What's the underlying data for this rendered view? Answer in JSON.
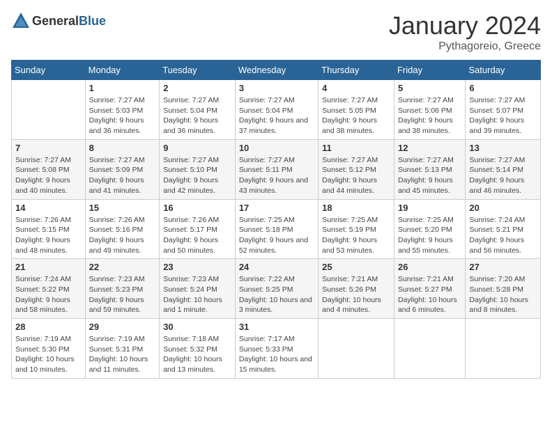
{
  "header": {
    "logo_general": "General",
    "logo_blue": "Blue",
    "title": "January 2024",
    "location": "Pythagoreio, Greece"
  },
  "days_of_week": [
    "Sunday",
    "Monday",
    "Tuesday",
    "Wednesday",
    "Thursday",
    "Friday",
    "Saturday"
  ],
  "weeks": [
    [
      {
        "day": "",
        "sunrise": "",
        "sunset": "",
        "daylight": ""
      },
      {
        "day": "1",
        "sunrise": "Sunrise: 7:27 AM",
        "sunset": "Sunset: 5:03 PM",
        "daylight": "Daylight: 9 hours and 36 minutes."
      },
      {
        "day": "2",
        "sunrise": "Sunrise: 7:27 AM",
        "sunset": "Sunset: 5:04 PM",
        "daylight": "Daylight: 9 hours and 36 minutes."
      },
      {
        "day": "3",
        "sunrise": "Sunrise: 7:27 AM",
        "sunset": "Sunset: 5:04 PM",
        "daylight": "Daylight: 9 hours and 37 minutes."
      },
      {
        "day": "4",
        "sunrise": "Sunrise: 7:27 AM",
        "sunset": "Sunset: 5:05 PM",
        "daylight": "Daylight: 9 hours and 38 minutes."
      },
      {
        "day": "5",
        "sunrise": "Sunrise: 7:27 AM",
        "sunset": "Sunset: 5:06 PM",
        "daylight": "Daylight: 9 hours and 38 minutes."
      },
      {
        "day": "6",
        "sunrise": "Sunrise: 7:27 AM",
        "sunset": "Sunset: 5:07 PM",
        "daylight": "Daylight: 9 hours and 39 minutes."
      }
    ],
    [
      {
        "day": "7",
        "sunrise": "Sunrise: 7:27 AM",
        "sunset": "Sunset: 5:08 PM",
        "daylight": "Daylight: 9 hours and 40 minutes."
      },
      {
        "day": "8",
        "sunrise": "Sunrise: 7:27 AM",
        "sunset": "Sunset: 5:09 PM",
        "daylight": "Daylight: 9 hours and 41 minutes."
      },
      {
        "day": "9",
        "sunrise": "Sunrise: 7:27 AM",
        "sunset": "Sunset: 5:10 PM",
        "daylight": "Daylight: 9 hours and 42 minutes."
      },
      {
        "day": "10",
        "sunrise": "Sunrise: 7:27 AM",
        "sunset": "Sunset: 5:11 PM",
        "daylight": "Daylight: 9 hours and 43 minutes."
      },
      {
        "day": "11",
        "sunrise": "Sunrise: 7:27 AM",
        "sunset": "Sunset: 5:12 PM",
        "daylight": "Daylight: 9 hours and 44 minutes."
      },
      {
        "day": "12",
        "sunrise": "Sunrise: 7:27 AM",
        "sunset": "Sunset: 5:13 PM",
        "daylight": "Daylight: 9 hours and 45 minutes."
      },
      {
        "day": "13",
        "sunrise": "Sunrise: 7:27 AM",
        "sunset": "Sunset: 5:14 PM",
        "daylight": "Daylight: 9 hours and 46 minutes."
      }
    ],
    [
      {
        "day": "14",
        "sunrise": "Sunrise: 7:26 AM",
        "sunset": "Sunset: 5:15 PM",
        "daylight": "Daylight: 9 hours and 48 minutes."
      },
      {
        "day": "15",
        "sunrise": "Sunrise: 7:26 AM",
        "sunset": "Sunset: 5:16 PM",
        "daylight": "Daylight: 9 hours and 49 minutes."
      },
      {
        "day": "16",
        "sunrise": "Sunrise: 7:26 AM",
        "sunset": "Sunset: 5:17 PM",
        "daylight": "Daylight: 9 hours and 50 minutes."
      },
      {
        "day": "17",
        "sunrise": "Sunrise: 7:25 AM",
        "sunset": "Sunset: 5:18 PM",
        "daylight": "Daylight: 9 hours and 52 minutes."
      },
      {
        "day": "18",
        "sunrise": "Sunrise: 7:25 AM",
        "sunset": "Sunset: 5:19 PM",
        "daylight": "Daylight: 9 hours and 53 minutes."
      },
      {
        "day": "19",
        "sunrise": "Sunrise: 7:25 AM",
        "sunset": "Sunset: 5:20 PM",
        "daylight": "Daylight: 9 hours and 55 minutes."
      },
      {
        "day": "20",
        "sunrise": "Sunrise: 7:24 AM",
        "sunset": "Sunset: 5:21 PM",
        "daylight": "Daylight: 9 hours and 56 minutes."
      }
    ],
    [
      {
        "day": "21",
        "sunrise": "Sunrise: 7:24 AM",
        "sunset": "Sunset: 5:22 PM",
        "daylight": "Daylight: 9 hours and 58 minutes."
      },
      {
        "day": "22",
        "sunrise": "Sunrise: 7:23 AM",
        "sunset": "Sunset: 5:23 PM",
        "daylight": "Daylight: 9 hours and 59 minutes."
      },
      {
        "day": "23",
        "sunrise": "Sunrise: 7:23 AM",
        "sunset": "Sunset: 5:24 PM",
        "daylight": "Daylight: 10 hours and 1 minute."
      },
      {
        "day": "24",
        "sunrise": "Sunrise: 7:22 AM",
        "sunset": "Sunset: 5:25 PM",
        "daylight": "Daylight: 10 hours and 3 minutes."
      },
      {
        "day": "25",
        "sunrise": "Sunrise: 7:21 AM",
        "sunset": "Sunset: 5:26 PM",
        "daylight": "Daylight: 10 hours and 4 minutes."
      },
      {
        "day": "26",
        "sunrise": "Sunrise: 7:21 AM",
        "sunset": "Sunset: 5:27 PM",
        "daylight": "Daylight: 10 hours and 6 minutes."
      },
      {
        "day": "27",
        "sunrise": "Sunrise: 7:20 AM",
        "sunset": "Sunset: 5:28 PM",
        "daylight": "Daylight: 10 hours and 8 minutes."
      }
    ],
    [
      {
        "day": "28",
        "sunrise": "Sunrise: 7:19 AM",
        "sunset": "Sunset: 5:30 PM",
        "daylight": "Daylight: 10 hours and 10 minutes."
      },
      {
        "day": "29",
        "sunrise": "Sunrise: 7:19 AM",
        "sunset": "Sunset: 5:31 PM",
        "daylight": "Daylight: 10 hours and 11 minutes."
      },
      {
        "day": "30",
        "sunrise": "Sunrise: 7:18 AM",
        "sunset": "Sunset: 5:32 PM",
        "daylight": "Daylight: 10 hours and 13 minutes."
      },
      {
        "day": "31",
        "sunrise": "Sunrise: 7:17 AM",
        "sunset": "Sunset: 5:33 PM",
        "daylight": "Daylight: 10 hours and 15 minutes."
      },
      {
        "day": "",
        "sunrise": "",
        "sunset": "",
        "daylight": ""
      },
      {
        "day": "",
        "sunrise": "",
        "sunset": "",
        "daylight": ""
      },
      {
        "day": "",
        "sunrise": "",
        "sunset": "",
        "daylight": ""
      }
    ]
  ]
}
